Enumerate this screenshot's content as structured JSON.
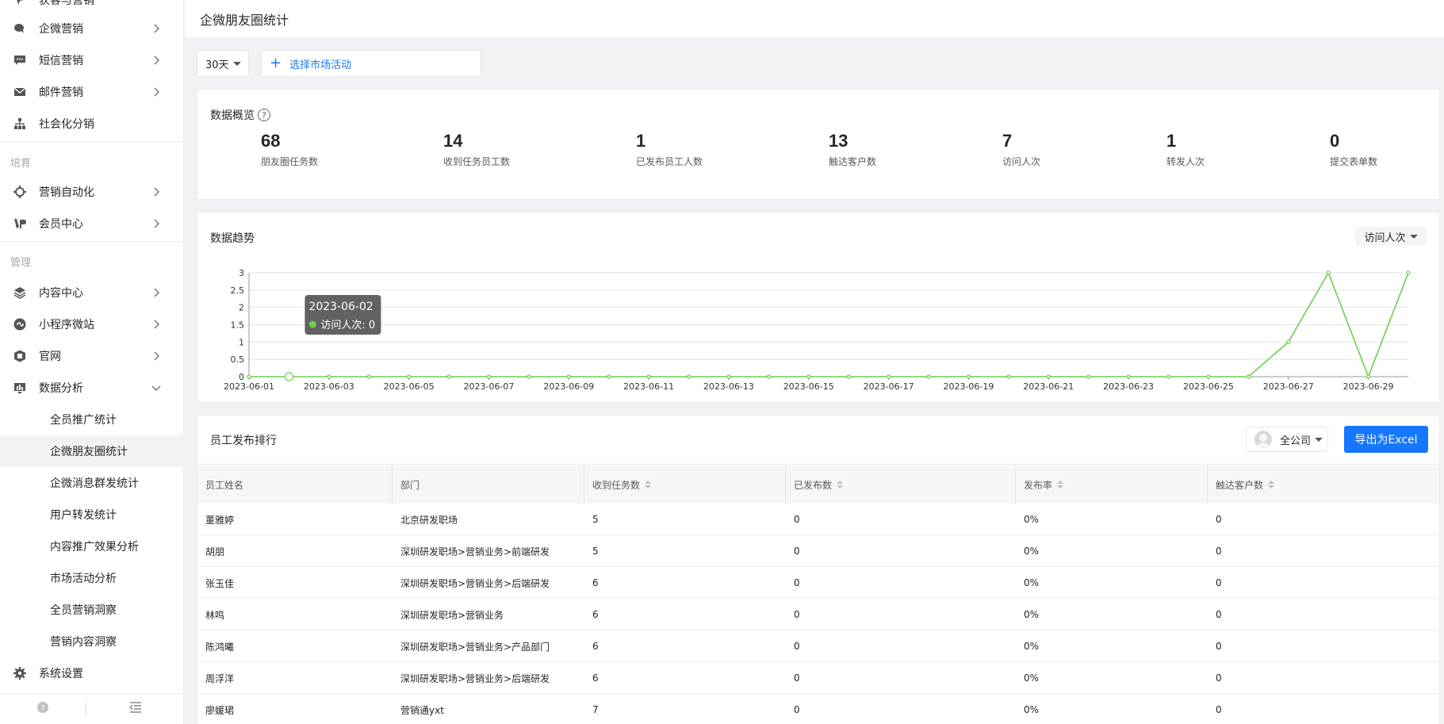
{
  "sidebar": {
    "top_partial_label": "获客与营销",
    "items": [
      {
        "label": "企微营销",
        "icon": "wechat-work-icon"
      },
      {
        "label": "短信营销",
        "icon": "sms-icon"
      },
      {
        "label": "邮件营销",
        "icon": "mail-icon"
      },
      {
        "label": "社会化分销",
        "icon": "org-tree-icon"
      }
    ],
    "group_nurture": "培育",
    "nurture_items": [
      {
        "label": "营销自动化",
        "icon": "automation-icon"
      },
      {
        "label": "会员中心",
        "icon": "vip-icon"
      }
    ],
    "group_manage": "管理",
    "manage_items": [
      {
        "label": "内容中心",
        "icon": "layers-icon"
      },
      {
        "label": "小程序微站",
        "icon": "mini-program-icon"
      },
      {
        "label": "官网",
        "icon": "website-icon"
      },
      {
        "label": "数据分析",
        "icon": "analytics-icon"
      }
    ],
    "analytics_sub": [
      "全员推广统计",
      "企微朋友圈统计",
      "企微消息群发统计",
      "用户转发统计",
      "内容推广效果分析",
      "市场活动分析",
      "全员营销洞察",
      "营销内容洞察"
    ],
    "settings_label": "系统设置"
  },
  "header": {
    "title": "企微朋友圈统计"
  },
  "filters": {
    "period": "30天",
    "activity_placeholder": "选择市场活动"
  },
  "overview": {
    "title": "数据概览",
    "stats": [
      {
        "value": "68",
        "label": "朋友圈任务数"
      },
      {
        "value": "14",
        "label": "收到任务员工数"
      },
      {
        "value": "1",
        "label": "已发布员工人数"
      },
      {
        "value": "13",
        "label": "触达客户数"
      },
      {
        "value": "7",
        "label": "访问人次"
      },
      {
        "value": "1",
        "label": "转发人次"
      },
      {
        "value": "0",
        "label": "提交表单数"
      }
    ]
  },
  "trend": {
    "title": "数据趋势",
    "metric_select": "访问人次",
    "tooltip": {
      "date": "2023-06-02",
      "label": "访问人次: 0"
    }
  },
  "chart_data": {
    "type": "line",
    "x": [
      "2023-06-01",
      "2023-06-02",
      "2023-06-03",
      "2023-06-04",
      "2023-06-05",
      "2023-06-06",
      "2023-06-07",
      "2023-06-08",
      "2023-06-09",
      "2023-06-10",
      "2023-06-11",
      "2023-06-12",
      "2023-06-13",
      "2023-06-14",
      "2023-06-15",
      "2023-06-16",
      "2023-06-17",
      "2023-06-18",
      "2023-06-19",
      "2023-06-20",
      "2023-06-21",
      "2023-06-22",
      "2023-06-23",
      "2023-06-24",
      "2023-06-25",
      "2023-06-26",
      "2023-06-27",
      "2023-06-28",
      "2023-06-29",
      "2023-06-30"
    ],
    "xticks": [
      "2023-06-01",
      "2023-06-03",
      "2023-06-05",
      "2023-06-07",
      "2023-06-09",
      "2023-06-11",
      "2023-06-13",
      "2023-06-15",
      "2023-06-17",
      "2023-06-19",
      "2023-06-21",
      "2023-06-23",
      "2023-06-25",
      "2023-06-27",
      "2023-06-29"
    ],
    "series": [
      {
        "name": "访问人次",
        "values": [
          0,
          0,
          0,
          0,
          0,
          0,
          0,
          0,
          0,
          0,
          0,
          0,
          0,
          0,
          0,
          0,
          0,
          0,
          0,
          0,
          0,
          0,
          0,
          0,
          0,
          0,
          1,
          3,
          0,
          3
        ]
      }
    ],
    "yticks": [
      "0",
      "0.5",
      "1",
      "1.5",
      "2",
      "2.5",
      "3"
    ],
    "ylim": [
      0,
      3
    ],
    "grid": true,
    "color": "#6ccf4f"
  },
  "ranking": {
    "title": "员工发布排行",
    "scope": "全公司",
    "export_label": "导出为Excel",
    "columns": [
      "员工姓名",
      "部门",
      "收到任务数",
      "已发布数",
      "发布率",
      "触达客户数"
    ],
    "rows": [
      [
        "董雅婷",
        "北京研发职场",
        "5",
        "0",
        "0%",
        "0"
      ],
      [
        "胡朋",
        "深圳研发职场>营销业务>前端研发",
        "5",
        "0",
        "0%",
        "0"
      ],
      [
        "张玉佳",
        "深圳研发职场>营销业务>后端研发",
        "6",
        "0",
        "0%",
        "0"
      ],
      [
        "林鸣",
        "深圳研发职场>营销业务",
        "6",
        "0",
        "0%",
        "0"
      ],
      [
        "陈鸿曦",
        "深圳研发职场>营销业务>产品部门",
        "6",
        "0",
        "0%",
        "0"
      ],
      [
        "周浮洋",
        "深圳研发职场>营销业务>后端研发",
        "6",
        "0",
        "0%",
        "0"
      ],
      [
        "廖媛珺",
        "营销通yxt",
        "7",
        "0",
        "0%",
        "0"
      ]
    ]
  }
}
